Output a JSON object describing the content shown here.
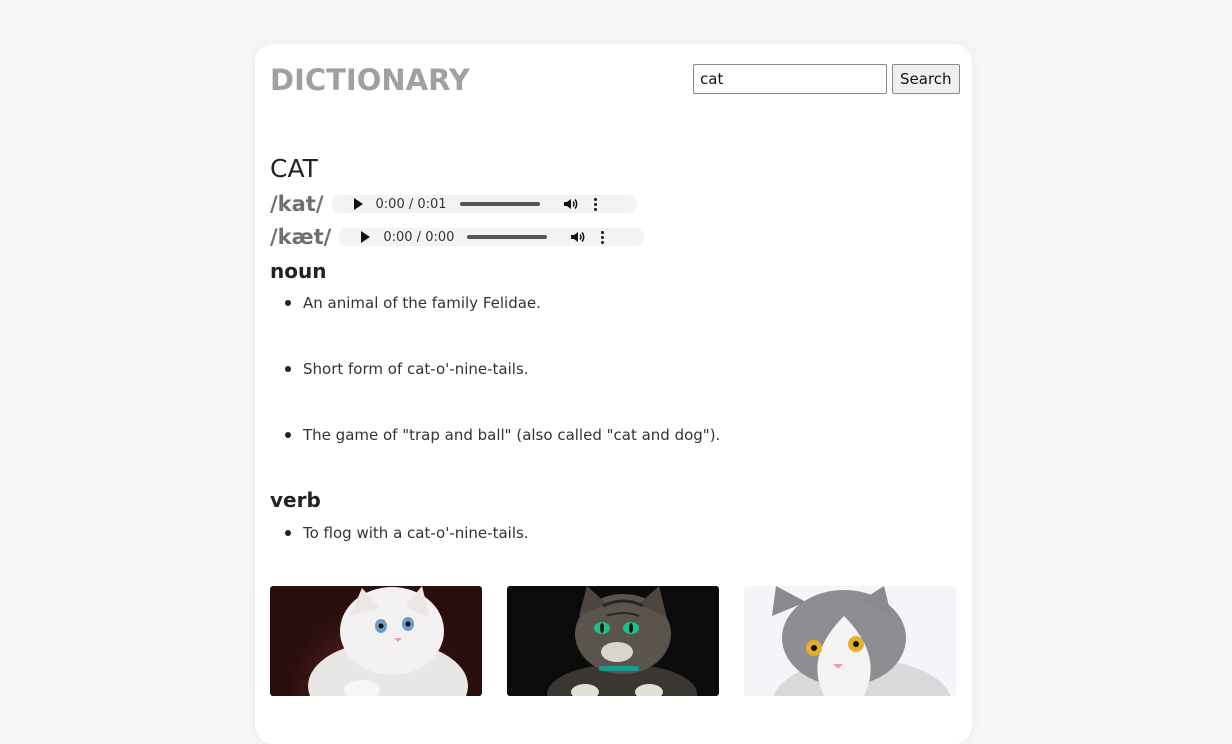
{
  "header": {
    "brand": "DICTIONARY",
    "search_value": "cat",
    "search_button": "Search"
  },
  "entry": {
    "word": "CAT",
    "phonetics": [
      {
        "text": "/kat/",
        "time": "0:00 / 0:01"
      },
      {
        "text": "/kæt/",
        "time": "0:00 / 0:00"
      }
    ],
    "meanings": [
      {
        "part_of_speech": "noun",
        "definitions": [
          "An animal of the family Felidae.",
          "Short form of cat-o'-nine-tails.",
          "The game of \"trap and ball\" (also called \"cat and dog\")."
        ]
      },
      {
        "part_of_speech": "verb",
        "definitions": [
          "To flog with a cat-o'-nine-tails."
        ]
      }
    ]
  },
  "images": [
    {
      "subject": "white-kitten-photo",
      "bg": "#2a0d0d"
    },
    {
      "subject": "tabby-cat-photo",
      "bg": "#0b0b0b"
    },
    {
      "subject": "gray-white-cat-photo",
      "bg": "#f4f5f8"
    }
  ],
  "colors": {
    "page_bg": "#f6f7f9",
    "card_bg": "#ffffff",
    "brand": "#a0a0a0",
    "phonetic": "#707070"
  }
}
